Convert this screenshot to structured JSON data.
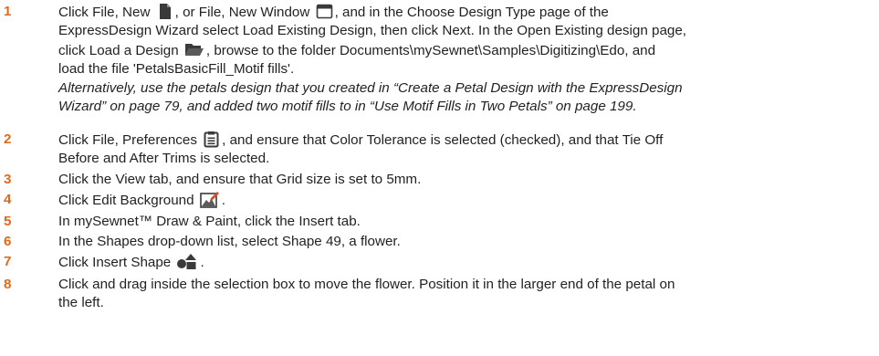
{
  "steps": [
    {
      "number": "1",
      "lines": [
        {
          "a": "Click File, New ",
          "b": ", or File, New Window ",
          "c": ", and in the Choose Design Type page of the"
        },
        "ExpressDesign Wizard select Load Existing Design, then click Next. In the Open Existing design page,",
        {
          "a": "click Load a Design ",
          "b": ", browse to the folder Documents\\mySewnet\\Samples\\Digitizing\\Edo, and"
        },
        "load the file 'PetalsBasicFill_Motif fills'."
      ],
      "note_lines": [
        "Alternatively, use the petals design that you created in “Create a Petal Design with the ExpressDesign",
        "Wizard” on page 79, and added two motif fills to in “Use Motif Fills in Two Petals” on page 199."
      ]
    },
    {
      "number": "2",
      "lines": [
        {
          "a": "Click File, Preferences ",
          "b": ", and ensure that Color Tolerance is selected (checked), and that Tie Off"
        },
        "Before and After Trims is selected."
      ]
    },
    {
      "number": "3",
      "lines": [
        "Click the View tab, and ensure that Grid size is set to 5mm."
      ]
    },
    {
      "number": "4",
      "lines": [
        {
          "a": "Click Edit Background ",
          "b": "."
        }
      ]
    },
    {
      "number": "5",
      "lines": [
        "In mySewnet™ Draw & Paint, click the Insert tab."
      ]
    },
    {
      "number": "6",
      "lines": [
        "In the Shapes drop-down list, select Shape 49, a flower."
      ]
    },
    {
      "number": "7",
      "lines": [
        {
          "a": "Click Insert Shape ",
          "b": "."
        }
      ]
    },
    {
      "number": "8",
      "lines": [
        "Click and drag inside the selection box to move the flower. Position it in the larger end of the petal on",
        "the left."
      ]
    }
  ],
  "icons": {
    "new": "new-file-icon",
    "new_window": "new-window-icon",
    "load_design": "open-folder-icon",
    "preferences": "preferences-clipboard-icon",
    "edit_background": "edit-background-icon",
    "insert_shape": "insert-shape-icon"
  },
  "colors": {
    "step_number": "#e06a1b",
    "text": "#231f20",
    "icon": "#3a3a3a"
  }
}
